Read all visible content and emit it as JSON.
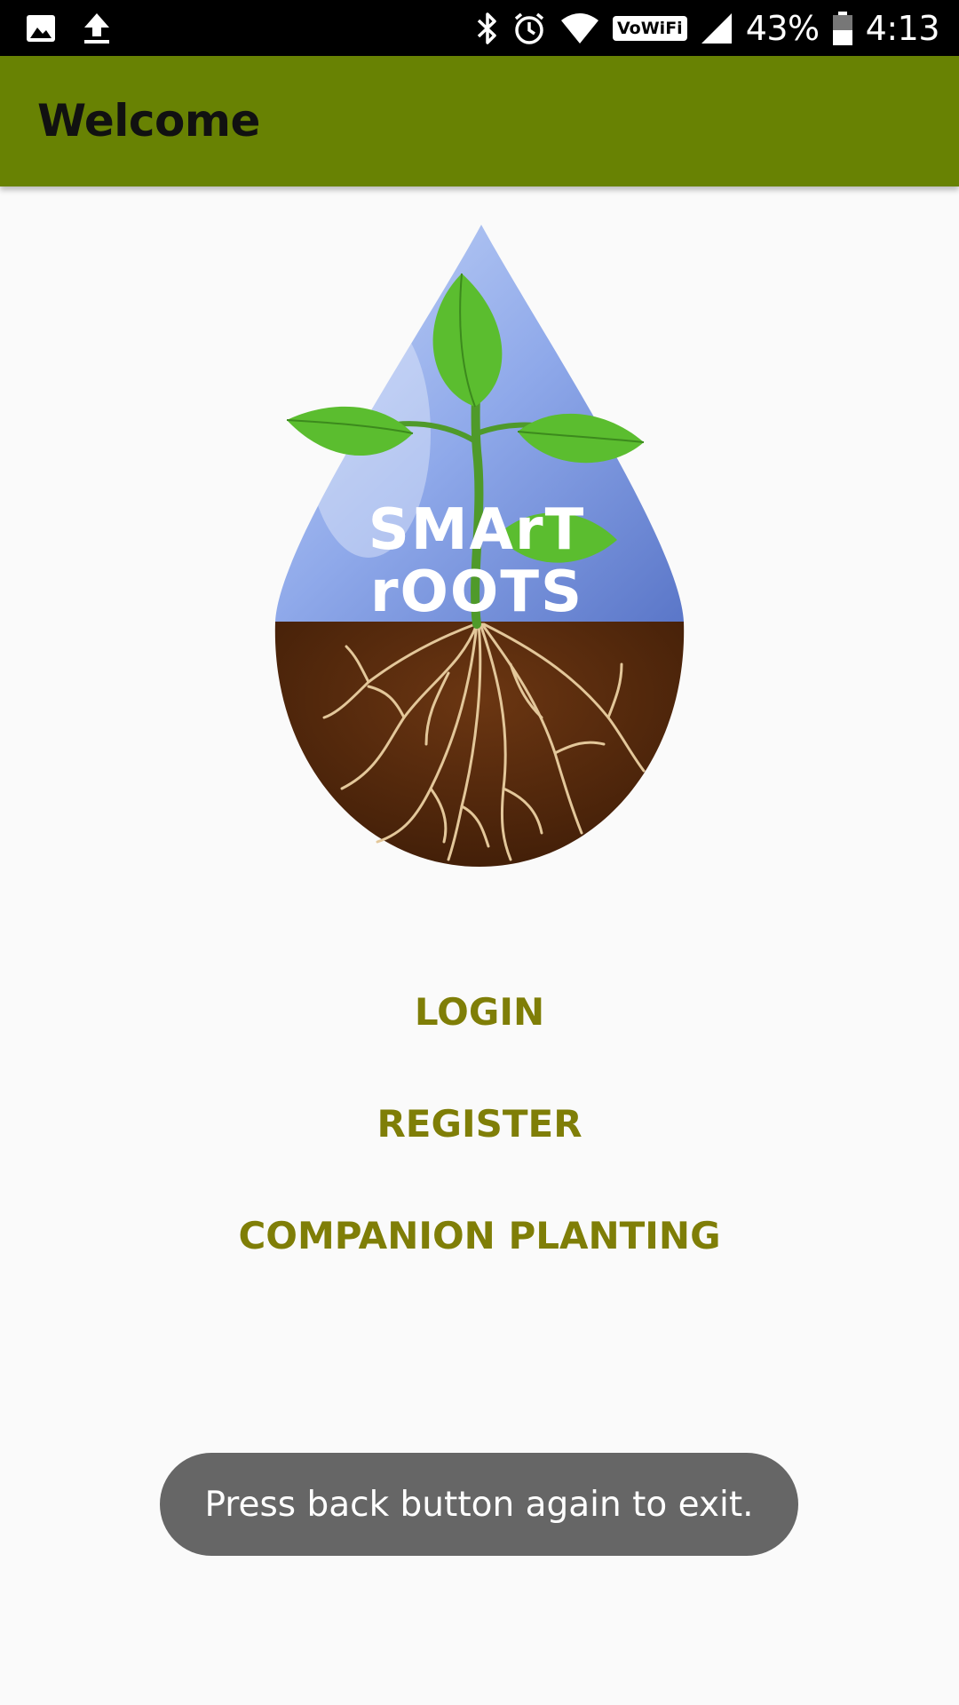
{
  "status_bar": {
    "battery_percent": "43%",
    "time": "4:13",
    "vowifi_label": "VoWiFi",
    "icons": [
      "image-icon",
      "upload-icon",
      "bluetooth-icon",
      "alarm-icon",
      "wifi-icon",
      "signal-icon",
      "battery-icon"
    ]
  },
  "app_bar": {
    "title": "Welcome",
    "color": "#688203"
  },
  "logo": {
    "line1": "SMArT",
    "line2": "rOOTS"
  },
  "menu": {
    "login_label": "LOGIN",
    "register_label": "REGISTER",
    "companion_label": "COMPANION PLANTING",
    "text_color": "#7f7e07"
  },
  "toast": {
    "message": "Press back button again to exit."
  }
}
